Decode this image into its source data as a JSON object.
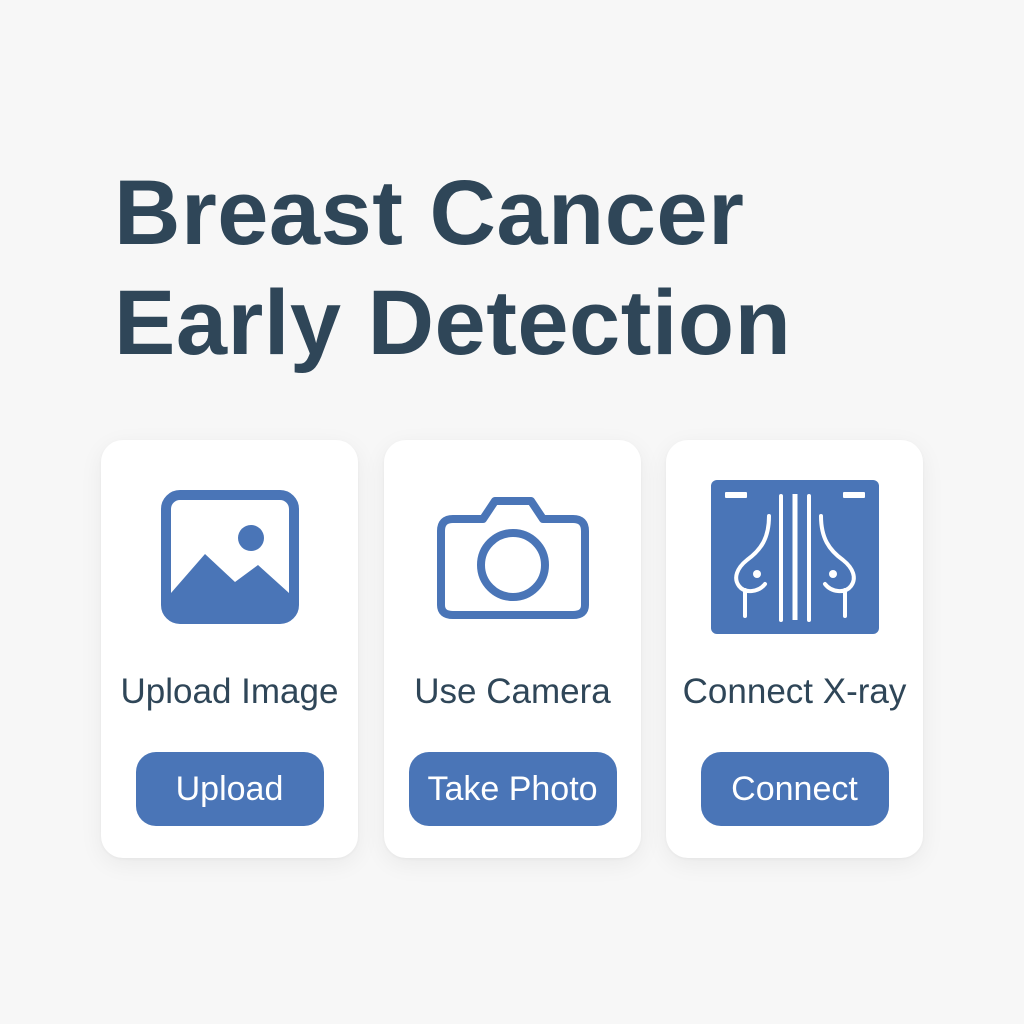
{
  "header": {
    "title_line1": "Breast Cancer",
    "title_line2": "Early Detection"
  },
  "cards": [
    {
      "icon": "image-icon",
      "label": "Upload Image",
      "button_label": "Upload"
    },
    {
      "icon": "camera-icon",
      "label": "Use Camera",
      "button_label": "Take Photo"
    },
    {
      "icon": "xray-icon",
      "label": "Connect X-ray",
      "button_label": "Connect"
    }
  ],
  "colors": {
    "background": "#f7f7f7",
    "card": "#ffffff",
    "title_text": "#2f4658",
    "accent": "#4a75b7"
  }
}
